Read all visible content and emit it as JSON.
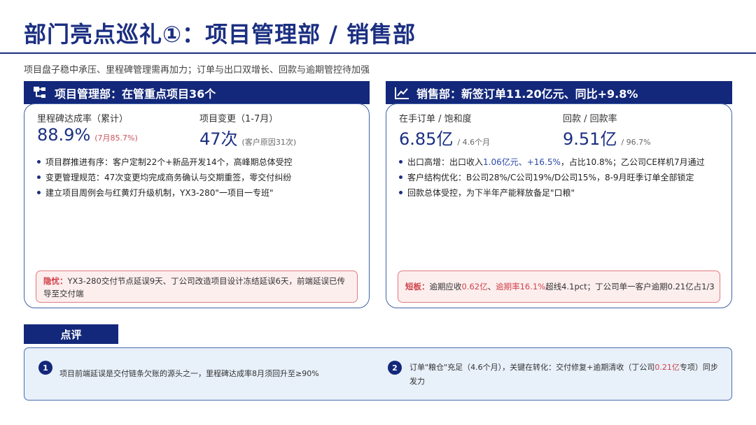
{
  "title": "部门亮点巡礼①：项目管理部 / 销售部",
  "subtitle": "项目盘子稳中承压、里程碑管理需再加力；订单与出口双增长、回款与逾期管控待加强",
  "colors": {
    "navy": "#13287a",
    "accent": "#1b2f82",
    "warn_red": "#d0424b",
    "warn_bg": "#fdeeee",
    "review_bg": "#e8f0fa"
  },
  "project": {
    "icon": "org-chart-icon",
    "header": "项目管理部：在管重点项目36个",
    "kpi1": {
      "label": "里程碑达成率（累计）",
      "value": "88.9%",
      "note": "(7月85.7%)"
    },
    "kpi2": {
      "label": "项目变更（1-7月）",
      "value": "47次",
      "note": "(客户原因31次)"
    },
    "bullets": [
      "项目群推进有序：客户定制22个+新品开发14个，高峰期总体受控",
      "变更管理规范：47次变更均完成商务确认与交期重签，零交付纠纷",
      "建立项目周例会与红黄灯升级机制，YX3-280\"一项目一专班\""
    ],
    "warning": {
      "tag": "隐忧：",
      "text": "YX3-280交付节点延误9天、丁公司改造项目设计冻结延误6天，前端延误已传导至交付端"
    }
  },
  "sales": {
    "icon": "trend-chart-icon",
    "header": "销售部：新签订单11.20亿元、同比+9.8%",
    "kpi1": {
      "label": "在手订单 / 饱和度",
      "value": "6.85亿",
      "note": "/ 4.6个月"
    },
    "kpi2": {
      "label": "回款 / 回款率",
      "value": "9.51亿",
      "note": "/ 96.7%"
    },
    "bullet1": {
      "prefix": "出口高增：出口收入",
      "hl": "1.06亿元、+16.5%",
      "suffix": "，占比10.8%；乙公司CE样机7月通过"
    },
    "bullet2": "客户结构优化：B公司28%/C公司19%/D公司15%，8-9月旺季订单全部锁定",
    "bullet3": "回款总体受控，为下半年产能释放备足\"口粮\"",
    "warning": {
      "tag": "短板：",
      "p1": "逾期应收",
      "r1": "0.62亿",
      "p2": "、",
      "r2": "逾期率16.1%",
      "p3": "超线4.1pct；丁公司单一客户逾期0.21亿占1/3"
    }
  },
  "review": {
    "header": "点评",
    "item1": {
      "num": "1",
      "text": "项目前端延误是交付链条欠账的源头之一，里程碑达成率8月须回升至≥90%"
    },
    "item2": {
      "num": "2",
      "p1": "订单\"粮仓\"充足（4.6个月），关键在转化：交付修复+逾期清收（丁公司",
      "red": "0.21亿",
      "p2": "专项）同步发力"
    }
  }
}
